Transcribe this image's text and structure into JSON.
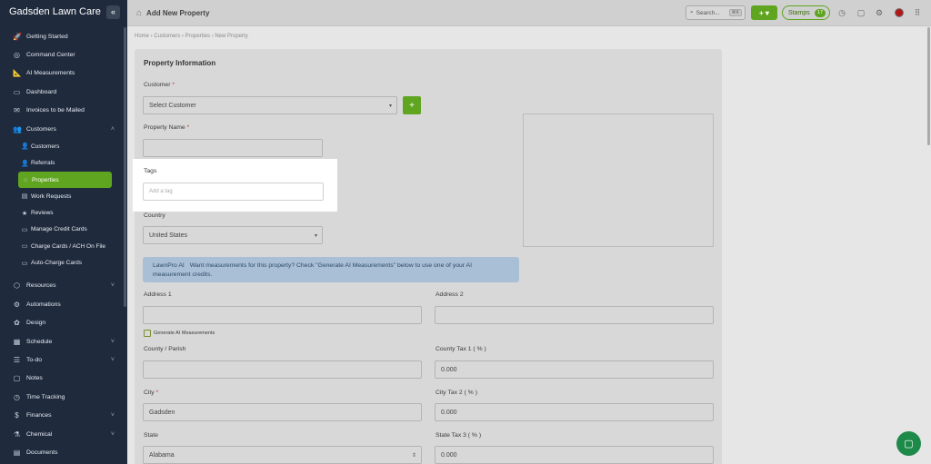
{
  "sidebar": {
    "brand": "Gadsden Lawn Care",
    "collapse_icon": "«",
    "items": [
      {
        "label": "Getting Started",
        "icon": "🚀"
      },
      {
        "label": "Command Center",
        "icon": "◎"
      },
      {
        "label": "AI Measurements",
        "icon": "📐"
      },
      {
        "label": "Dashboard",
        "icon": "▭"
      },
      {
        "label": "Invoices to be Mailed",
        "icon": "✉"
      },
      {
        "label": "Customers",
        "icon": "👥",
        "chevron": "˄"
      }
    ],
    "sub_items": [
      {
        "label": "Customers",
        "icon": "👤"
      },
      {
        "label": "Referrals",
        "icon": "👤"
      },
      {
        "label": "Properties",
        "icon": "⌂",
        "active": true
      },
      {
        "label": "Work Requests",
        "icon": "▤"
      },
      {
        "label": "Reviews",
        "icon": "★"
      },
      {
        "label": "Manage Credit Cards",
        "icon": "▭"
      },
      {
        "label": "Charge Cards / ACH On File",
        "icon": "▭"
      },
      {
        "label": "Auto-Charge Cards",
        "icon": "▭"
      }
    ],
    "items_bottom": [
      {
        "label": "Resources",
        "icon": "⬡",
        "chevron": "˅"
      },
      {
        "label": "Automations",
        "icon": "⚙"
      },
      {
        "label": "Design",
        "icon": "✿"
      },
      {
        "label": "Schedule",
        "icon": "▦",
        "chevron": "˅"
      },
      {
        "label": "To-do",
        "icon": "☰",
        "chevron": "˅"
      },
      {
        "label": "Notes",
        "icon": "▢"
      },
      {
        "label": "Time Tracking",
        "icon": "◷"
      },
      {
        "label": "Finances",
        "icon": "$",
        "chevron": "˅"
      },
      {
        "label": "Chemical",
        "icon": "⚗",
        "chevron": "˅"
      },
      {
        "label": "Documents",
        "icon": "▤"
      }
    ]
  },
  "topbar": {
    "title": "Add New Property",
    "search_placeholder": "Search...",
    "search_shortcut": "⌘K",
    "add_label": "+ ▾",
    "stamps_label": "Stamps",
    "stamps_count": "17"
  },
  "breadcrumb": "Home › Customers › Properties › New Property",
  "form": {
    "section_title": "Property Information",
    "customer_label": "Customer",
    "customer_value": "Select Customer",
    "property_name_label": "Property Name",
    "tags_label": "Tags",
    "tags_placeholder": "Add a tag",
    "country_label": "Country",
    "country_value": "United States",
    "ai_tag": "LawnPro AI",
    "ai_text": "Want measurements for this property? Check \"Generate AI Measurements\" below to use one of your AI measurement credits.",
    "address1_label": "Address 1",
    "address2_label": "Address 2",
    "generate_ai_label": "Generate AI Measurements",
    "county_label": "County / Parish",
    "county_tax1_label": "County Tax 1 ( % )",
    "county_tax1_value": "0.000",
    "city_label": "City",
    "city_value": "Gadsden",
    "city_tax2_label": "City Tax 2 ( % )",
    "city_tax2_value": "0.000",
    "state_label": "State",
    "state_value": "Alabama",
    "state_tax3_label": "State Tax 3 ( % )",
    "state_tax3_value": "0.000",
    "required_mark": "*"
  },
  "colors": {
    "accent": "#5fa51f",
    "sidebar": "#1f2a3d",
    "chat": "#1e8a4a"
  }
}
